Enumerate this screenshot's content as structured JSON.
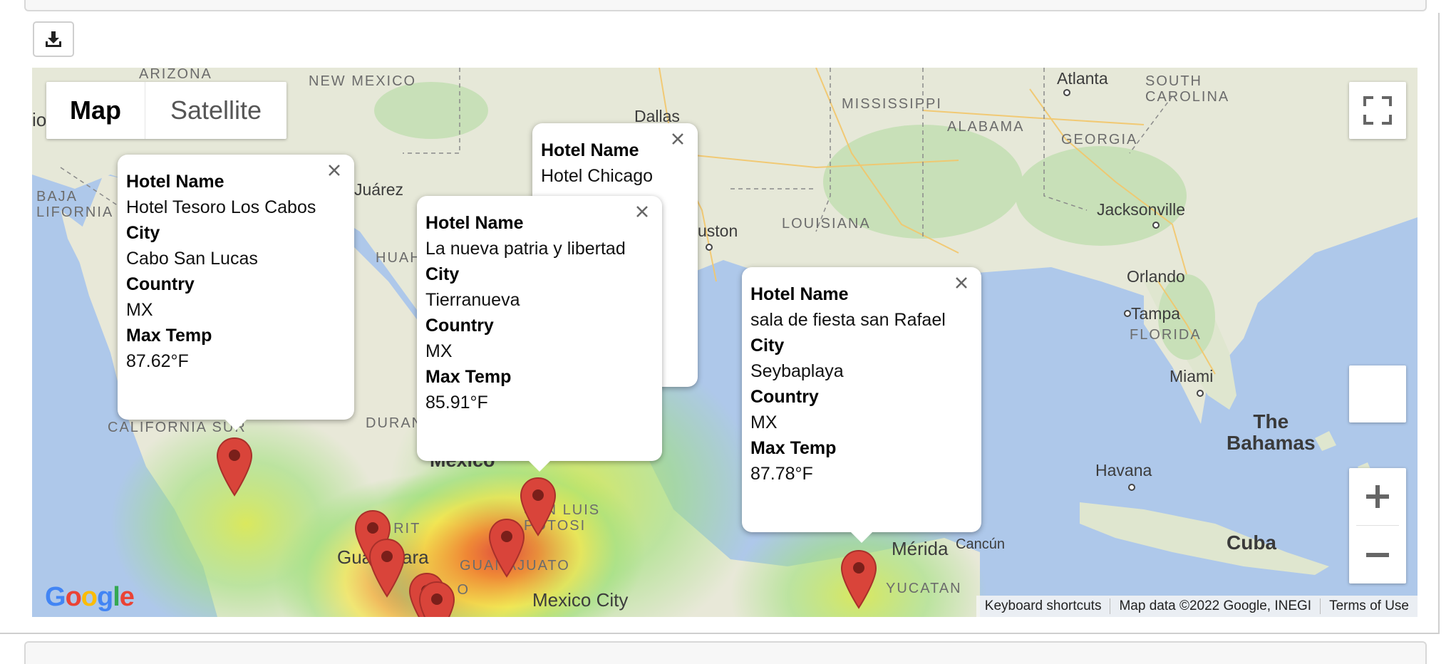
{
  "toolbar": {
    "download_icon": "download-icon"
  },
  "map": {
    "map_type": {
      "map_label": "Map",
      "satellite_label": "Satellite",
      "selected": "Map"
    },
    "controls": {
      "fullscreen_icon": "fullscreen-icon",
      "zoom_in": "+",
      "zoom_out": "−"
    },
    "places": {
      "arizona": "ARIZONA",
      "new_mexico": "NEW MEXICO",
      "mississippi": "MISSISSIPPI",
      "alabama": "ALABAMA",
      "georgia": "GEORGIA",
      "south_carolina": "SOUTH\nCAROLINA",
      "louisiana": "LOUISIANA",
      "florida": "FLORIDA",
      "baja_california": "BAJA\nLIFORNIA",
      "california_sur": "CALIFORNIA SUR",
      "chihuahua": "HUAHUA",
      "durango": "DURAN",
      "nayarit": "N   RIT",
      "guanajuato": "GUANAJUATO",
      "san_luis_potosi": "SAN LUIS\nPOTOSI",
      "jalisco": "JA    O",
      "yucatan": "YUCATAN",
      "atlanta": "Atlanta",
      "dallas": "Dallas",
      "houston": "uston",
      "juarez": "Juárez",
      "jacksonville": "Jacksonville",
      "orlando": "Orlando",
      "tampa": "Tampa",
      "miami": "Miami",
      "havana": "Havana",
      "cuba": "Cuba",
      "bahamas": "The\nBahamas",
      "mexico": "Mexico",
      "mexico_city": "Mexico City",
      "guadalajara": "Gua   ajara",
      "merida": "Mérida",
      "cancun": "Cancún",
      "left_edge": "io"
    },
    "popups": [
      {
        "hotel_name_label": "Hotel Name",
        "hotel_name": "Hotel Tesoro Los Cabos",
        "city_label": "City",
        "city": "Cabo San Lucas",
        "country_label": "Country",
        "country": "MX",
        "max_temp_label": "Max Temp",
        "max_temp": "87.62°F"
      },
      {
        "hotel_name_label": "Hotel Name",
        "hotel_name": "Hotel Chicago"
      },
      {
        "hotel_name_label": "Hotel Name",
        "hotel_name": "La nueva patria y libertad",
        "city_label": "City",
        "city": "Tierranueva",
        "country_label": "Country",
        "country": "MX",
        "max_temp_label": "Max Temp",
        "max_temp": "85.91°F"
      },
      {
        "hotel_name_label": "Hotel Name",
        "hotel_name": "sala de fiesta san Rafael",
        "city_label": "City",
        "city": "Seybaplaya",
        "country_label": "Country",
        "country": "MX",
        "max_temp_label": "Max Temp",
        "max_temp": "87.78°F"
      }
    ],
    "google_logo": "Google",
    "attribution": {
      "shortcuts": "Keyboard shortcuts",
      "map_data": "Map data ©2022 Google, INEGI",
      "terms": "Terms of Use"
    },
    "heatmap_colors": {
      "low": "#7ee07a",
      "mid": "#f4e64a",
      "high": "#f08030",
      "peak": "#e0443c"
    },
    "marker_color": "#d9443a"
  }
}
